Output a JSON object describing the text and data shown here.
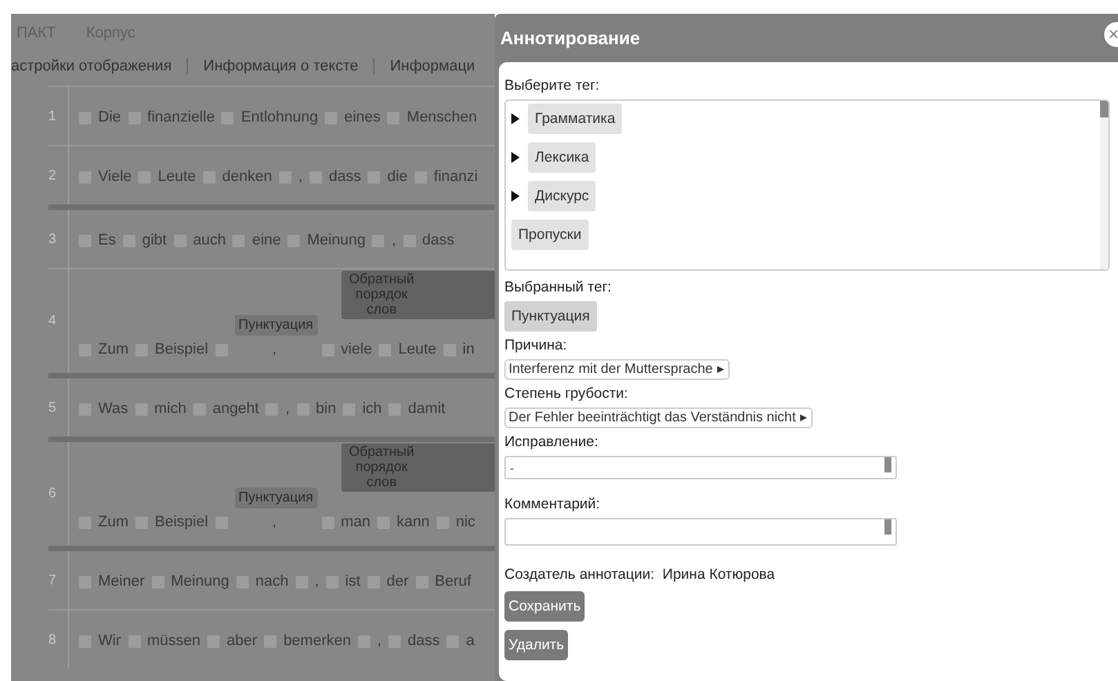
{
  "nav": [
    "ПАКТ",
    "Корпус"
  ],
  "tabs": [
    "астройки отображения",
    "Информация о тексте",
    "Информаци"
  ],
  "sentences": [
    {
      "number": "1",
      "thick_divider": false,
      "tokens": [
        {
          "word": "Die"
        },
        {
          "word": "finanzielle"
        },
        {
          "word": "Entlohnung"
        },
        {
          "word": "eines"
        },
        {
          "word": "Menschen"
        }
      ]
    },
    {
      "number": "2",
      "thick_divider": false,
      "tokens": [
        {
          "word": "Viele"
        },
        {
          "word": "Leute"
        },
        {
          "word": "denken"
        },
        {
          "word": ","
        },
        {
          "word": "dass"
        },
        {
          "word": "die"
        },
        {
          "word": "finanzi"
        }
      ]
    },
    {
      "number": "3",
      "thick_divider": true,
      "tokens": [
        {
          "word": "Es"
        },
        {
          "word": "gibt"
        },
        {
          "word": "auch"
        },
        {
          "word": "eine"
        },
        {
          "word": "Meinung"
        },
        {
          "word": ","
        },
        {
          "word": "dass"
        }
      ]
    },
    {
      "number": "4",
      "thick_divider": false,
      "tokens": [
        {
          "word": "Zum"
        },
        {
          "word": "Beispiel"
        },
        {
          "word": ",",
          "tags": [
            {
              "label": "Пунктуация",
              "kind": "punctuation"
            }
          ]
        },
        {
          "word": "viele",
          "tags": [
            {
              "label": "Обратный порядок слов",
              "kind": "word_order"
            }
          ]
        },
        {
          "word": "Leute"
        },
        {
          "word": "in"
        }
      ]
    },
    {
      "number": "5",
      "thick_divider": true,
      "tokens": [
        {
          "word": "Was"
        },
        {
          "word": "mich"
        },
        {
          "word": "angeht"
        },
        {
          "word": ","
        },
        {
          "word": "bin"
        },
        {
          "word": "ich"
        },
        {
          "word": "damit"
        }
      ]
    },
    {
      "number": "6",
      "thick_divider": true,
      "tokens": [
        {
          "word": "Zum"
        },
        {
          "word": "Beispiel"
        },
        {
          "word": ",",
          "tags": [
            {
              "label": "Пунктуация",
              "kind": "punctuation"
            }
          ]
        },
        {
          "word": "man",
          "tags": [
            {
              "label": "Обратный порядок слов",
              "kind": "word_order"
            }
          ]
        },
        {
          "word": "kann"
        },
        {
          "word": "nic"
        }
      ]
    },
    {
      "number": "7",
      "thick_divider": true,
      "tokens": [
        {
          "word": "Meiner"
        },
        {
          "word": "Meinung"
        },
        {
          "word": "nach"
        },
        {
          "word": ","
        },
        {
          "word": "ist"
        },
        {
          "word": "der"
        },
        {
          "word": "Beruf"
        }
      ]
    },
    {
      "number": "8",
      "thick_divider": false,
      "tokens": [
        {
          "word": "Wir"
        },
        {
          "word": "müssen"
        },
        {
          "word": "aber"
        },
        {
          "word": "bemerken"
        },
        {
          "word": ","
        },
        {
          "word": "dass"
        },
        {
          "word": "a"
        }
      ]
    }
  ],
  "dialog": {
    "title": "Аннотирование",
    "close": "×",
    "tag_prompt": "Выберите тег:",
    "tag_tree": [
      {
        "label": "Грамматика",
        "expandable": true
      },
      {
        "label": "Лексика",
        "expandable": true
      },
      {
        "label": "Дискурс",
        "expandable": true
      },
      {
        "label": "Пропуски",
        "expandable": false
      }
    ],
    "selected_tag_label": "Выбранный тег:",
    "selected_tag": "Пунктуация",
    "reason": {
      "label": "Причина:",
      "value": "Interferenz mit der Muttersprache"
    },
    "severity": {
      "label": "Степень грубости:",
      "value": "Der Fehler beeinträchtigt das Verständnis nicht"
    },
    "correction": {
      "label": "Исправление:",
      "value": "-"
    },
    "comment": {
      "label": "Комментарий:"
    },
    "creator": {
      "label": "Создатель аннотации:",
      "name": "Ирина Котюрова"
    },
    "buttons": [
      "Сохранить",
      "Удалить"
    ]
  }
}
